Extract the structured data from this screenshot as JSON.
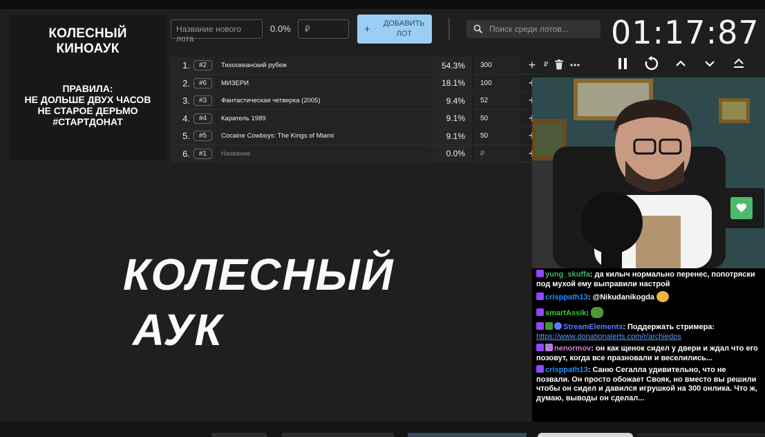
{
  "rules_panel": {
    "title_line1": "КОЛЕСНЫЙ",
    "title_line2": "КИНОАУК",
    "rules_line1": "ПРАВИЛА:",
    "rules_line2": "НЕ ДОЛЬШЕ ДВУХ ЧАСОВ",
    "rules_line3": "НЕ СТАРОЕ ДЕРЬМО",
    "rules_line4": "#СТАРТДОНАТ"
  },
  "controls": {
    "lot_placeholder": "Название нового лота",
    "new_percent": "0.0%",
    "amount_placeholder": "₽",
    "add_plus": "+",
    "add_label_line1": "ДОБАВИТЬ",
    "add_label_line2": "ЛОТ",
    "search_placeholder": "Поиск среди лотов..."
  },
  "timer": {
    "value": "01:17:87"
  },
  "lots": [
    {
      "num": "1.",
      "id": "#2",
      "name": "Тихоокеанский рубеж",
      "percent": "54.3%",
      "amount": "300",
      "action": "+"
    },
    {
      "num": "2.",
      "id": "#6",
      "name": "МИЗЕРИ",
      "percent": "18.1%",
      "amount": "100",
      "action": "+"
    },
    {
      "num": "3.",
      "id": "#3",
      "name": "Фантастическая четверка (2005)",
      "percent": "9.4%",
      "amount": "52",
      "action": "+"
    },
    {
      "num": "4.",
      "id": "#4",
      "name": "Каратель 1989",
      "percent": "9.1%",
      "amount": "50",
      "action": "+"
    },
    {
      "num": "5.",
      "id": "#5",
      "name": "Cocaine Cowboys: The Kings of Miami",
      "percent": "9.1%",
      "amount": "50",
      "action": "+"
    },
    {
      "num": "6.",
      "id": "#1",
      "name": "Название",
      "percent": "0.0%",
      "amount": "₽",
      "action": "+"
    }
  ],
  "row1_extra": {
    "currency": "₽"
  },
  "big_title": {
    "line1": "КОЛЕСНЫЙ",
    "line2": "АУК"
  },
  "chat": {
    "messages": [
      {
        "user": "yung_skuffa",
        "color": "#3cb371",
        "text": ": да килыч нормально перенес, попотряски под мухой ему выправили настрой"
      },
      {
        "user": "crisppath13",
        "color": "#1e90ff",
        "text": ": @Nikudanikogda"
      },
      {
        "user": "smartAssik",
        "color": "#32cd32",
        "text": ":"
      },
      {
        "user": "StreamElements",
        "color": "#5b7cff",
        "text": ": Поддержать стримера:",
        "link": "https://www.donationalerts.com/r/archiedos"
      },
      {
        "user": "nenormov",
        "color": "#d77bd7",
        "text": ": он как щенок сидел у двери и ждал что его позовут, когда все празновали и веселились..."
      },
      {
        "user": "crisppath13",
        "color": "#1e90ff",
        "text": ": Саню Сегалла удивительно, что не позвали. Он просто обожает Свояк, но вместо вы решили чтобы он сидел и давился игрушкой на 300 онлика. Что ж, думаю, выводы он сделал..."
      }
    ]
  },
  "colors": {
    "add_button": "#9ccef5",
    "heart_button": "#4cbb6c",
    "background": "#1f1f1f"
  },
  "icons": [
    "search-icon",
    "pause-icon",
    "restart-icon",
    "chevron-up-icon",
    "chevron-down-icon",
    "eject-icon",
    "trash-icon",
    "more-icon",
    "heart-icon",
    "twitch-icon"
  ]
}
